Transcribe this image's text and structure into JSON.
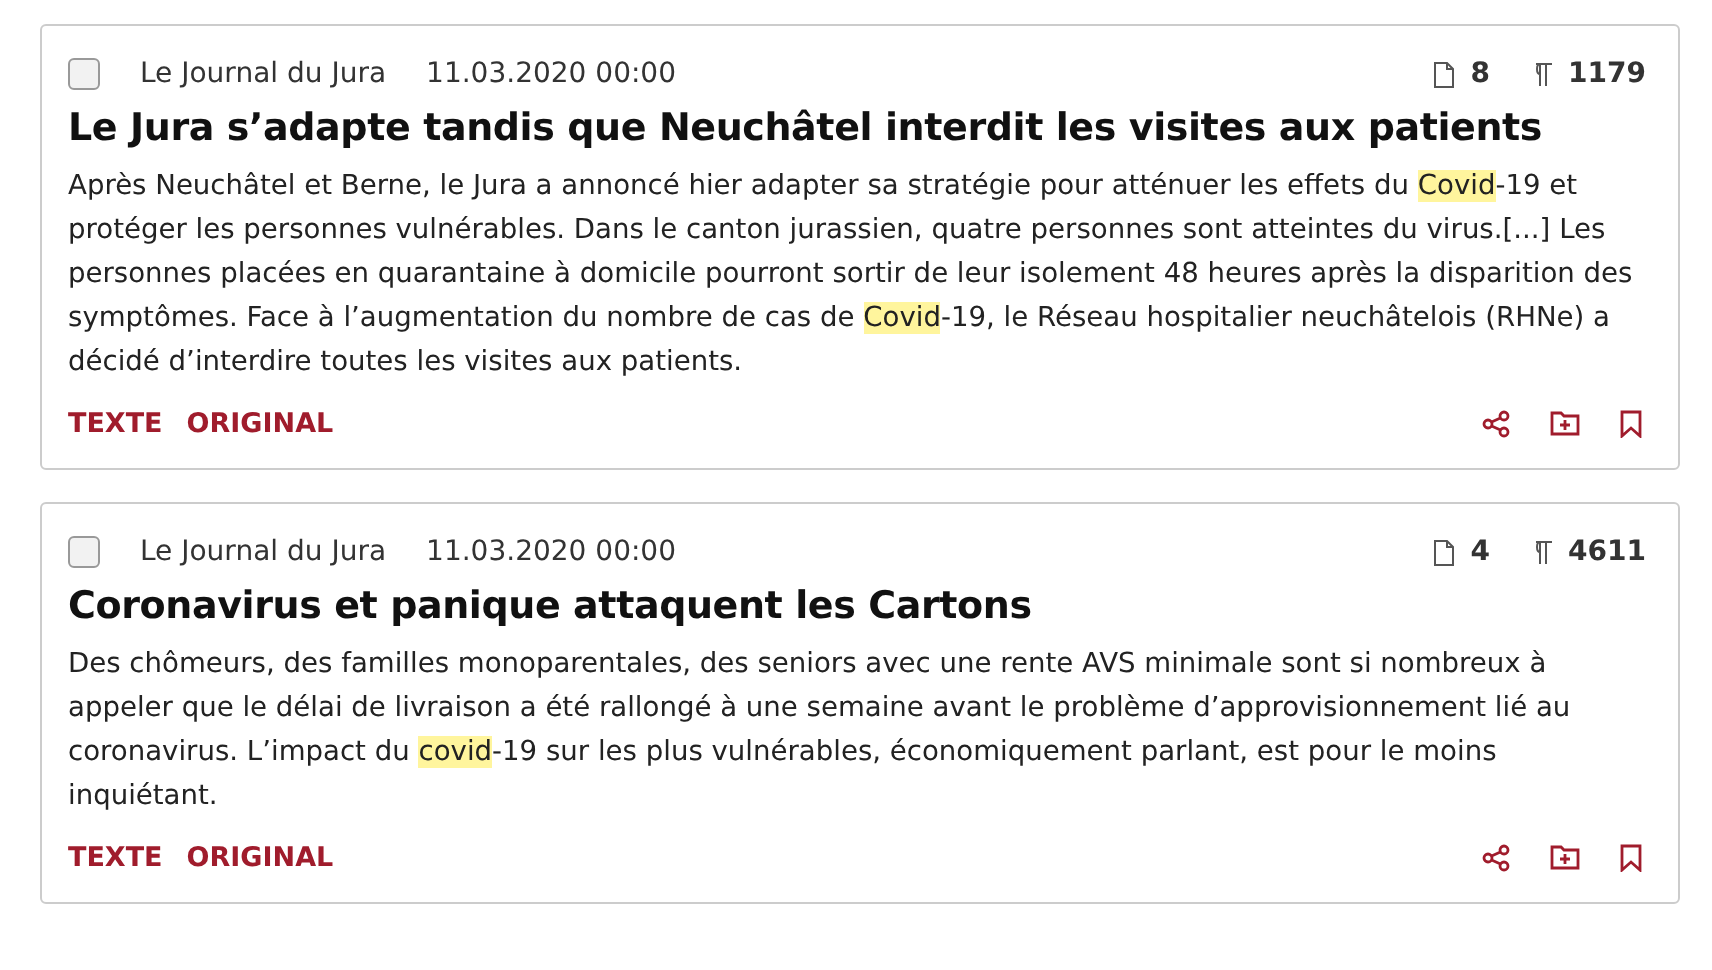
{
  "articles": [
    {
      "checked": false,
      "source": "Le Journal du Jura",
      "date": "11.03.2020 00:00",
      "pages": "8",
      "words": "1179",
      "title": "Le Jura s’adapte tandis que Neuchâtel interdit les visites aux patients",
      "body": [
        {
          "text": "Après Neuchâtel et Berne, le Jura a annoncé hier adapter sa stratégie pour atténuer les effets du ",
          "highlighted": false
        },
        {
          "text": "Covid",
          "highlighted": true
        },
        {
          "text": "-19 et protéger les personnes vulnérables. Dans le canton jurassien, quatre personnes sont atteintes du virus.[...] Les personnes placées en quarantaine à domicile pourront sortir de leur isolement 48 heures après la disparition des symptômes. Face à l’augmentation du nombre de cas de ",
          "highlighted": false
        },
        {
          "text": "Covid",
          "highlighted": true
        },
        {
          "text": "-19, le Réseau hospitalier neuchâtelois (RHNe) a décidé d’interdire toutes les visites aux patients.",
          "highlighted": false
        }
      ],
      "links": [
        "TEXTE",
        "ORIGINAL"
      ]
    },
    {
      "checked": false,
      "source": "Le Journal du Jura",
      "date": "11.03.2020 00:00",
      "pages": "4",
      "words": "4611",
      "title": "Coronavirus et panique attaquent les Cartons",
      "body": [
        {
          "text": "Des chômeurs, des familles monoparentales, des seniors avec une rente AVS minimale sont si nombreux à appeler que le délai de livraison a été rallongé à une semaine avant le problème d’approvisionnement lié au coronavirus. L’impact du ",
          "highlighted": false
        },
        {
          "text": "covid",
          "highlighted": true
        },
        {
          "text": "-19 sur les plus vulnérables, économiquement parlant, est pour le moins inquiétant.",
          "highlighted": false
        }
      ],
      "links": [
        "TEXTE",
        "ORIGINAL"
      ]
    }
  ]
}
